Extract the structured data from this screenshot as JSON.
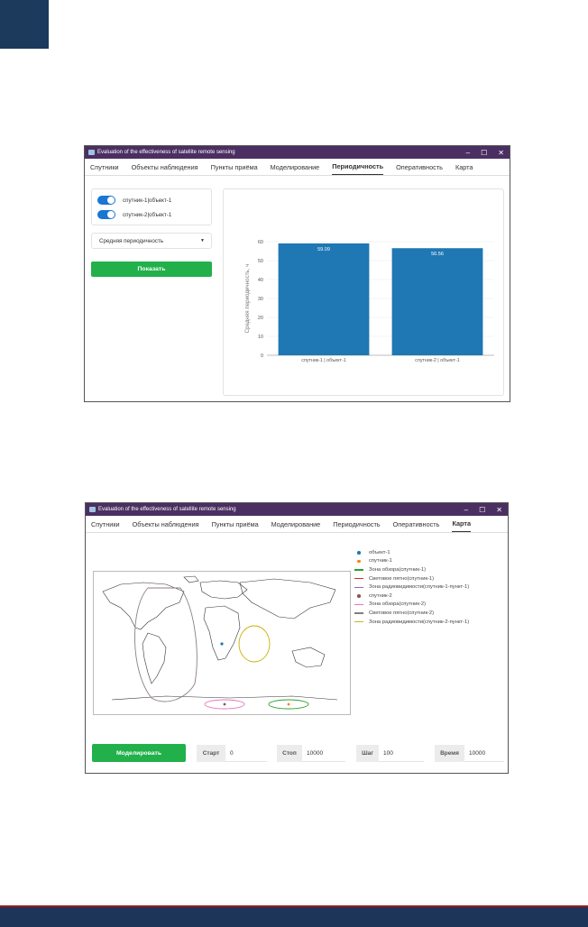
{
  "tabs": [
    "Спутники",
    "Объекты наблюдения",
    "Пункты приёма",
    "Моделирование",
    "Периодичность",
    "Оперативность",
    "Карта"
  ],
  "window1": {
    "title": "Evaluation of the effectiveness of satellite remote sensing",
    "active_tab": "Периодичность",
    "toggles": [
      {
        "label": "спутник-1|объект-1",
        "on": true
      },
      {
        "label": "спутник-2|объект-1",
        "on": true
      }
    ],
    "select_value": "Средняя периодичность",
    "show_button": "Показать"
  },
  "chart_data": {
    "type": "bar",
    "categories": [
      "спутник-1 | объект-1",
      "спутник-2 | объект-1"
    ],
    "values": [
      59.09,
      56.56
    ],
    "value_labels": [
      "59.09",
      "56.56"
    ],
    "ylabel": "Средняя периодичность, ч",
    "xlabel": "",
    "ylim": [
      0,
      60
    ],
    "yticks": [
      "0",
      "10",
      "20",
      "30",
      "40",
      "50",
      "60"
    ],
    "bar_color": "#1f77b4",
    "grid": true
  },
  "window2": {
    "title": "Evaluation of the effectiveness of satellite remote sensing",
    "active_tab": "Карта",
    "legend": [
      {
        "label": "объект-1",
        "kind": "dot",
        "color": "#1f77b4"
      },
      {
        "label": "спутник-1",
        "kind": "dot",
        "color": "#ff7f0e"
      },
      {
        "label": "Зона обзора(спутник-1)",
        "kind": "line",
        "color": "#2ca02c"
      },
      {
        "label": "Световое пятно(спутник-1)",
        "kind": "line",
        "color": "#d62728"
      },
      {
        "label": "Зона радиовидимости(спутник-1-пункт-1)",
        "kind": "line",
        "color": "#9467bd"
      },
      {
        "label": "спутник-2",
        "kind": "dot",
        "color": "#8c564b"
      },
      {
        "label": "Зона обзора(спутник-2)",
        "kind": "line",
        "color": "#e377c2"
      },
      {
        "label": "Световое пятно(спутник-2)",
        "kind": "line",
        "color": "#7f7f7f"
      },
      {
        "label": "Зона радиовидимости(спутник-2-пункт-1)",
        "kind": "line",
        "color": "#bcbd22"
      }
    ],
    "simulate_button": "Моделировать",
    "params": [
      {
        "label": "Старт",
        "value": "0"
      },
      {
        "label": "Стоп",
        "value": "10000"
      },
      {
        "label": "Шаг",
        "value": "100"
      },
      {
        "label": "Время",
        "value": "10000"
      }
    ]
  }
}
